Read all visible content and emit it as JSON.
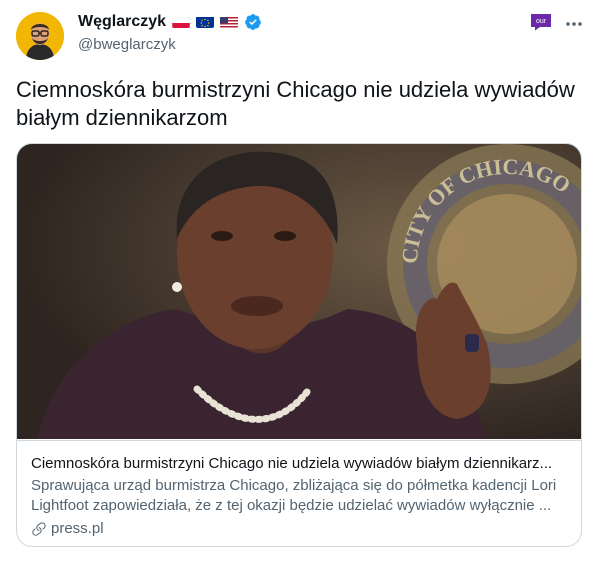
{
  "author": {
    "display_name": "Węglarczyk",
    "handle": "@bweglarczyk",
    "flags": [
      "poland-flag",
      "eu-flag",
      "us-flag"
    ],
    "verified_icon": "verified-badge-icon"
  },
  "header": {
    "extension_badge": "our",
    "more_icon": "more-options-icon"
  },
  "tweet": {
    "text": "Ciemnoskóra burmistrzyni Chicago nie udziela wywiadów białym dziennikarzom"
  },
  "card": {
    "title": "Ciemnoskóra burmistrzyni Chicago nie udziela wywiadów białym dziennikarz...",
    "description": "Sprawująca urząd burmistrza Chicago, zbliżająca się do półmetka kadencji Lori Lightfoot zapowiedziała, że z tej okazji będzie udzielać wywiadów wyłącznie ...",
    "domain": "press.pl",
    "image_seal_text": "CITY OF CHICAGO"
  },
  "colors": {
    "text_primary": "#0f1419",
    "text_secondary": "#536471",
    "verified": "#1d9bf0",
    "border": "#cfd9de",
    "badge": "#6d2aa8"
  }
}
